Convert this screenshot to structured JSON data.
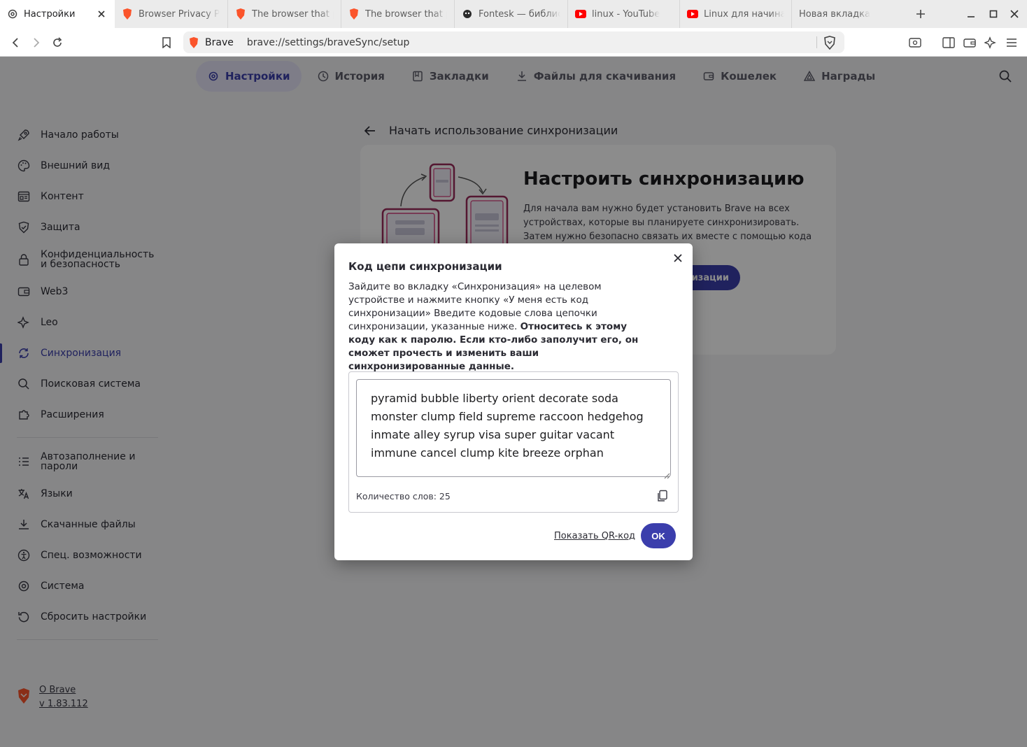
{
  "tabs": [
    {
      "label": "Настройки",
      "icon": "gear-icon",
      "active": true
    },
    {
      "label": "Browser Privacy P",
      "icon": "brave-icon"
    },
    {
      "label": "The browser that p",
      "icon": "brave-icon"
    },
    {
      "label": "The browser that p",
      "icon": "brave-icon"
    },
    {
      "label": "Fontesk — библиo",
      "icon": "fontesk-icon"
    },
    {
      "label": "linux - YouTube",
      "icon": "youtube-icon"
    },
    {
      "label": "Linux для начина",
      "icon": "youtube-icon"
    },
    {
      "label": "Новая вкладка",
      "icon": ""
    }
  ],
  "omnibox": {
    "chip": "Brave",
    "url": "brave://settings/braveSync/setup"
  },
  "topnav": [
    {
      "label": "Настройки",
      "icon": "gear-icon",
      "active": true
    },
    {
      "label": "История",
      "icon": "history-icon"
    },
    {
      "label": "Закладки",
      "icon": "bookmarks-icon"
    },
    {
      "label": "Файлы для скачивания",
      "icon": "download-icon"
    },
    {
      "label": "Кошелек",
      "icon": "wallet-icon"
    },
    {
      "label": "Награды",
      "icon": "rewards-icon"
    }
  ],
  "sidebar": {
    "group1": [
      {
        "label": "Начало работы",
        "icon": "rocket-icon"
      },
      {
        "label": "Внешний вид",
        "icon": "palette-icon"
      },
      {
        "label": "Контент",
        "icon": "content-icon"
      },
      {
        "label": "Защита",
        "icon": "shield-icon"
      },
      {
        "label1": "Конфиденциальность",
        "label2": "и безопасность",
        "icon": "lock-icon"
      },
      {
        "label": "Web3",
        "icon": "wallet-icon"
      },
      {
        "label": "Leo",
        "icon": "leo-icon"
      },
      {
        "label": "Синхронизация",
        "icon": "sync-icon",
        "active": true
      },
      {
        "label": "Поисковая система",
        "icon": "search-icon"
      },
      {
        "label": "Расширения",
        "icon": "puzzle-icon"
      }
    ],
    "group2": [
      {
        "label1": "Автозаполнение и",
        "label2": "пароли",
        "icon": "list-icon"
      },
      {
        "label": "Языки",
        "icon": "translate-icon"
      },
      {
        "label": "Скачанные файлы",
        "icon": "download-icon"
      },
      {
        "label": "Спец. возможности",
        "icon": "accessibility-icon"
      },
      {
        "label": "Система",
        "icon": "gear-icon"
      },
      {
        "label": "Сбросить настройки",
        "icon": "reset-icon"
      }
    ],
    "about": {
      "label": "О Brave",
      "version": "v 1.83.112"
    }
  },
  "main": {
    "back_title": "Начать использование синхронизации",
    "card_title": "Настроить синхронизацию",
    "card_text": "Для начала вам нужно будет установить Brave на всех устройствах, которые вы планируете синхронизировать. Затем нужно безопасно связать их вместе с помощью кода",
    "start_button": "изации"
  },
  "dialog": {
    "title": "Код цепи синхронизации",
    "body": "Зайдите во вкладку «Синхронизация» на целевом устройстве и нажмите кнопку «У меня есть код синхронизации» Введите кодовые слова цепочки синхронизации, указанные ниже.",
    "body_bold": "Относитесь к этому коду как к паролю. Если кто-либо заполучит его, он сможет прочесть и изменить ваши синхронизированные данные.",
    "code": "pyramid bubble liberty orient decorate soda monster clump field supreme raccoon hedgehog inmate alley syrup visa super guitar vacant immune cancel clump kite breeze orphan",
    "word_count": "Количество слов: 25",
    "qr_link": "Показать QR-код",
    "ok": "OK"
  },
  "colors": {
    "accent": "#3b3eac",
    "active_nav_bg": "#e5e4f7"
  }
}
